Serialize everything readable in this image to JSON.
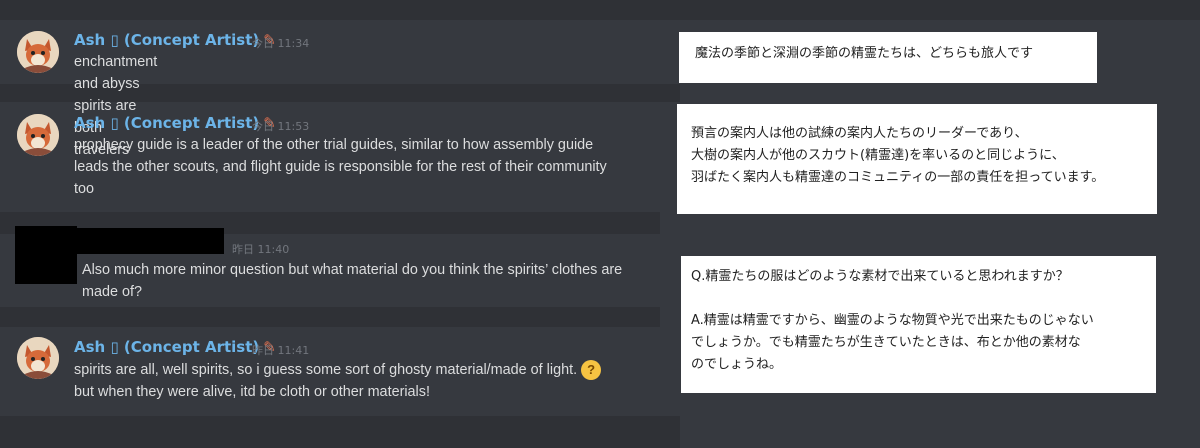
{
  "messages": [
    {
      "author": "Ash   (Concept Artist)",
      "author_display": "Ash ▯ (Concept Artist)",
      "time": "今日 11:34",
      "text": "enchantment and abyss spirits are both travelers"
    },
    {
      "author_display": "Ash ▯ (Concept Artist)",
      "time": "今日 11:53",
      "lines": [
        "prophecy guide is a leader of the other trial guides, similar to how assembly guide",
        "leads the other scouts, and flight guide is responsible for the rest of their community",
        "too"
      ]
    },
    {
      "time": "昨日 11:40",
      "lines": [
        "Also much more minor question but what material do you think the spirits’ clothes are",
        "made of?"
      ]
    },
    {
      "author_display": "Ash ▯ (Concept Artist)",
      "time": "昨日 11:41",
      "lines": [
        "spirits are all, well spirits, so i guess some sort of ghosty material/made of light.",
        "but when they were alive, itd be cloth or other materials!"
      ],
      "emoji": "thinking-face-emoji"
    }
  ],
  "translations": [
    {
      "lines": [
        "魔法の季節と深淵の季節の精霊たちは、どちらも旅人です"
      ]
    },
    {
      "lines": [
        "預言の案内人は他の試練の案内人たちのリーダーであり、",
        "大樹の案内人が他のスカウト(精霊達)を率いるのと同じように、",
        "羽ばたく案内人も精霊達のコミュニティの一部の責任を担っています。"
      ]
    },
    {
      "lines": [
        "Q.精霊たちの服はどのような素材で出来ていると思われますか？",
        "",
        "A.精霊は精霊ですから、幽霊のような物質や光で出来たものじゃない",
        "でしょうか。でも精霊たちが生きていたときは、布とか他の素材な",
        "のでしょうね。"
      ]
    }
  ],
  "icons": {
    "feather": "feather-icon",
    "avatar": "fox-avatar"
  },
  "colors": {
    "background": "#36393f",
    "username": "#6cb4e8",
    "text": "#dcddde",
    "timestamp": "#72767d"
  }
}
